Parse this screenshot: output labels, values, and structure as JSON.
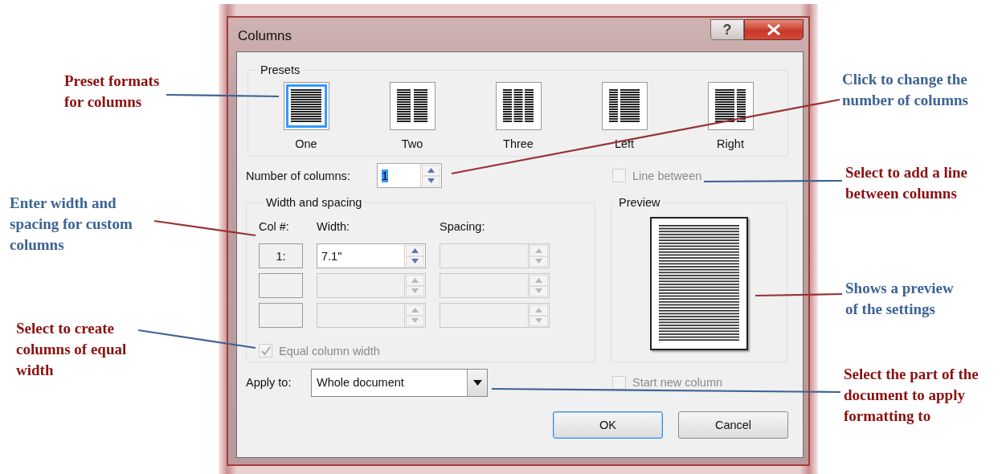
{
  "dialog": {
    "title": "Columns",
    "help_button": "?",
    "presets": {
      "legend": "Presets",
      "items": [
        {
          "label": "One",
          "kind": "one",
          "selected": true
        },
        {
          "label": "Two",
          "kind": "two",
          "selected": false
        },
        {
          "label": "Three",
          "kind": "three",
          "selected": false
        },
        {
          "label": "Left",
          "kind": "left",
          "selected": false
        },
        {
          "label": "Right",
          "kind": "right",
          "selected": false
        }
      ]
    },
    "number_of_columns": {
      "label": "Number of columns:",
      "value": "1"
    },
    "line_between": {
      "label": "Line between",
      "checked": false,
      "disabled": true
    },
    "width_and_spacing": {
      "legend": "Width and spacing",
      "headers": [
        "Col #:",
        "Width:",
        "Spacing:"
      ],
      "rows": [
        {
          "col": "1:",
          "width": "7.1\"",
          "width_disabled": false,
          "spacing_disabled": true
        },
        {
          "width_disabled": true,
          "spacing_disabled": true
        },
        {
          "width_disabled": true,
          "spacing_disabled": true
        }
      ]
    },
    "equal_column_width": {
      "label": "Equal column width",
      "checked": true,
      "disabled": true
    },
    "preview": {
      "legend": "Preview"
    },
    "apply_to": {
      "label": "Apply to:",
      "value": "Whole document"
    },
    "start_new_column": {
      "label": "Start new column",
      "checked": false,
      "disabled": true
    },
    "buttons": [
      {
        "label": "OK",
        "default": true
      },
      {
        "label": "Cancel",
        "default": false
      }
    ]
  },
  "callouts": [
    {
      "text": "Preset formats\nfor columns",
      "color": "#8b1111",
      "leader": {
        "color": "#3d6394"
      }
    },
    {
      "text": "Click to change the\nnumber of columns",
      "color": "#3d6394",
      "leader": {
        "color": "#973232"
      }
    },
    {
      "text": "Select to add a line\nbetween columns",
      "color": "#8b1111",
      "leader": {
        "color": "#3d6394"
      }
    },
    {
      "text": "Enter width and\nspacing for custom\ncolumns",
      "color": "#3d6394",
      "leader": {
        "color": "#973232"
      }
    },
    {
      "text": "Shows a preview\nof the settings",
      "color": "#3d6394",
      "leader": {
        "color": "#973232"
      }
    },
    {
      "text": "Select to create\ncolumns of equal\nwidth",
      "color": "#8b1111",
      "leader": {
        "color": "#3d6394"
      }
    },
    {
      "text": "Select the part of the\ndocument to apply\nformatting to",
      "color": "#8b1111",
      "leader": {
        "color": "#3d6394"
      }
    }
  ]
}
